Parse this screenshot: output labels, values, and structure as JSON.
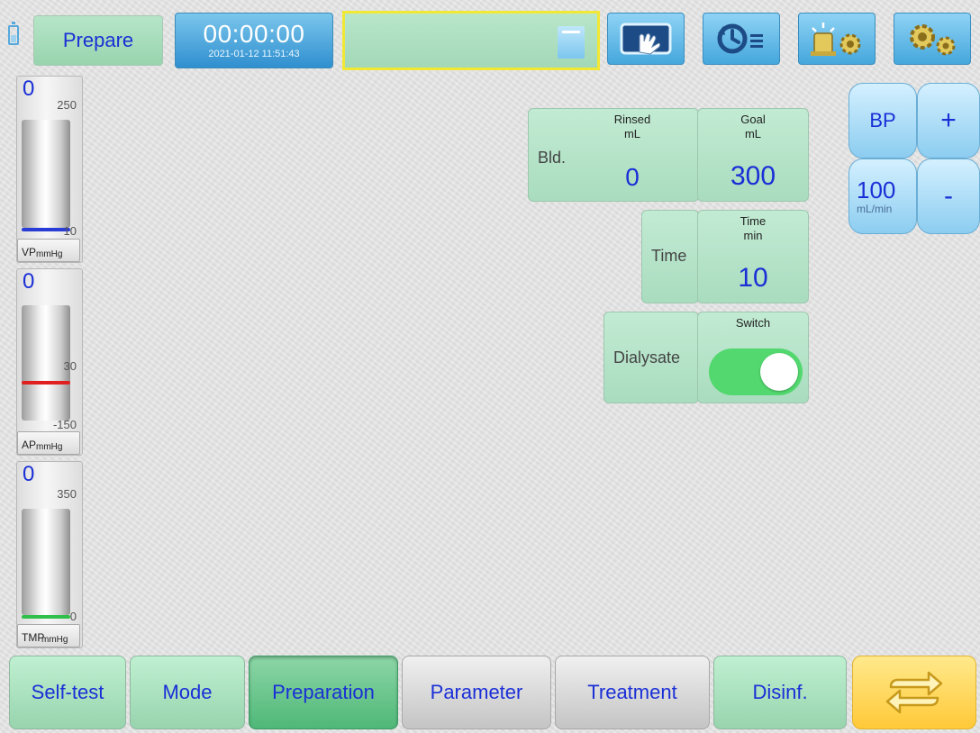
{
  "header": {
    "status_label": "Prepare",
    "clock": {
      "time": "00:00:00",
      "date": "2021-01-12 11:51:43"
    },
    "toolbar_icons": [
      "hand-touch-icon",
      "clock-history-icon",
      "alarm-settings-icon",
      "settings-gears-icon"
    ]
  },
  "gauges": {
    "vp": {
      "value": "0",
      "upper": "250",
      "lower": "10",
      "name": "VP",
      "unit": "mmHg",
      "marker_color": "#2a3cd6"
    },
    "ap": {
      "value": "0",
      "upper": "30",
      "lower": "-150",
      "name": "AP",
      "unit": "mmHg",
      "marker_color": "#e02020"
    },
    "tmp": {
      "value": "0",
      "upper": "350",
      "lower": "0",
      "name": "TMP",
      "unit": "mmHg",
      "marker_color": "#2fbf4a"
    }
  },
  "blood": {
    "label": "Bld.",
    "rinsed": {
      "title": "Rinsed",
      "unit": "mL",
      "value": "0"
    },
    "goal": {
      "title": "Goal",
      "unit": "mL",
      "value": "300"
    }
  },
  "time": {
    "label": "Time",
    "title": "Time",
    "unit": "min",
    "value": "10"
  },
  "dialysate": {
    "label": "Dialysate",
    "switch_title": "Switch",
    "switch_on": true
  },
  "blood_pump": {
    "label": "BP",
    "rate": "100",
    "rate_unit": "mL/min",
    "plus": "+",
    "minus": "-"
  },
  "tabs": [
    {
      "label": "Self-test",
      "state": "green"
    },
    {
      "label": "Mode",
      "state": "green"
    },
    {
      "label": "Preparation",
      "state": "active"
    },
    {
      "label": "Parameter",
      "state": "grey"
    },
    {
      "label": "Treatment",
      "state": "grey"
    },
    {
      "label": "Disinf.",
      "state": "green"
    }
  ],
  "colors": {
    "value_blue": "#1a2fd6",
    "tile_green": "#b6e5c8",
    "toggle_green": "#52d86e",
    "swap_yellow": "#ffd44f"
  }
}
